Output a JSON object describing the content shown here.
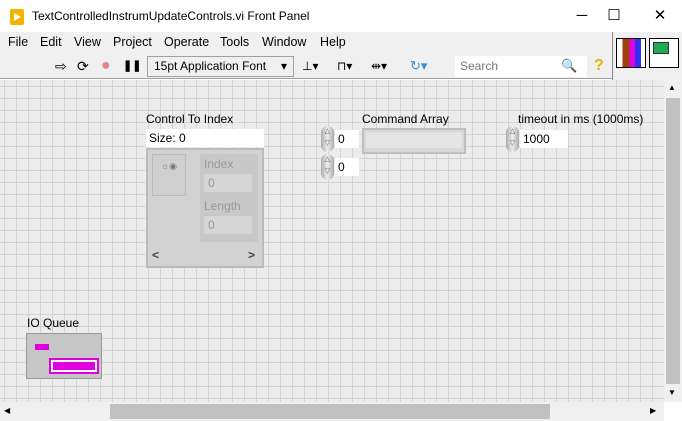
{
  "window": {
    "title": "TextControlledInstrumUpdateControls.vi Front Panel",
    "minimize": "─",
    "maximize": "☐",
    "close": "✕"
  },
  "menu": [
    "File",
    "Edit",
    "View",
    "Project",
    "Operate",
    "Tools",
    "Window",
    "Help"
  ],
  "toolbar": {
    "run": "⇨",
    "run_continuous": "⟳",
    "abort": "●",
    "pause": "❚❚",
    "font": "15pt Application Font",
    "font_arrow": "▾",
    "align": "⊥▾",
    "distribute": "⊓▾",
    "resize": "⇹▾",
    "reorder": "↻▾",
    "search_placeholder": "Search",
    "search_icon": "🔍",
    "help": "?"
  },
  "controls": {
    "control_to_index": {
      "label": "Control To Index",
      "size": "Size: 0",
      "index_label": "Index",
      "index_value": "0",
      "length_label": "Length",
      "length_value": "0",
      "left": "<",
      "right": ">"
    },
    "command_array": {
      "label": "Command Array",
      "index0": "0",
      "index1": "0"
    },
    "timeout": {
      "label": "timeout in ms (1000ms)",
      "value": "1000"
    },
    "io_queue": {
      "label": "IO Queue"
    }
  },
  "colors": {
    "accent": "#f3b400",
    "queue": "#e000e0"
  }
}
